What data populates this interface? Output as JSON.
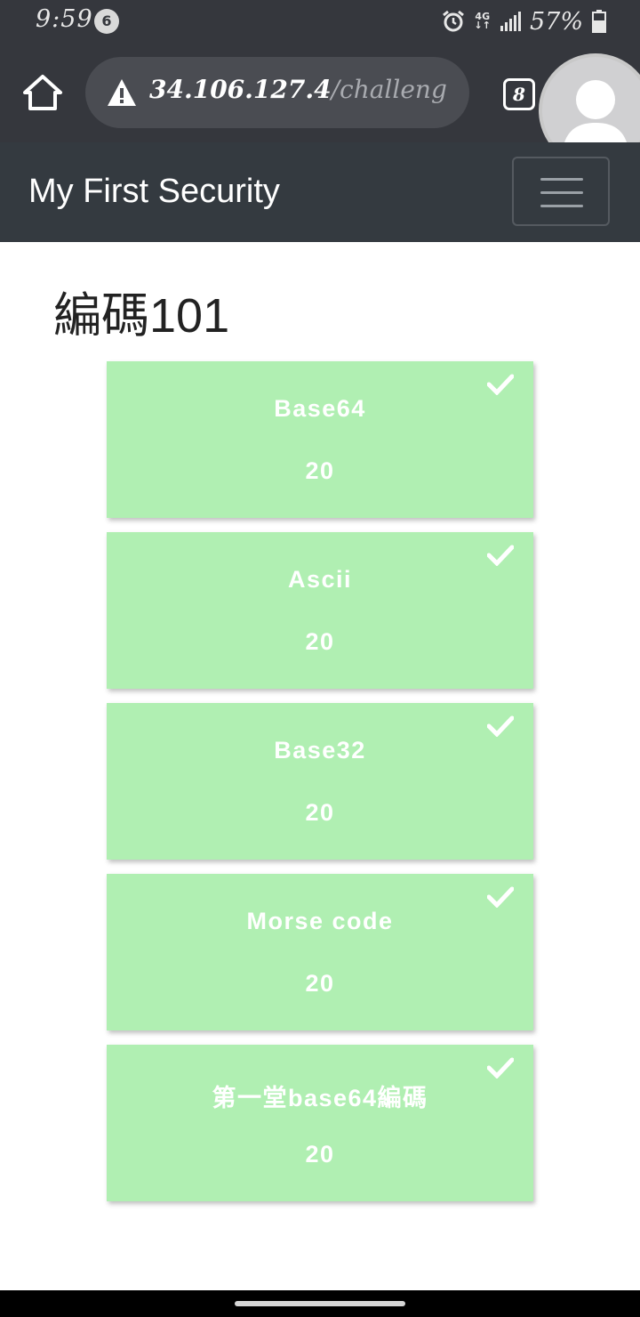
{
  "status_bar": {
    "time": "9:59",
    "notification_count": "6",
    "network": "4G",
    "battery": "57%",
    "icons": [
      "alarm-icon",
      "network-icon",
      "signal-icon",
      "battery-icon"
    ]
  },
  "browser": {
    "url_host": "34.106.127.4",
    "url_path": "/challeng",
    "tab_count": "8",
    "icons": [
      "home-icon",
      "warning-icon",
      "tabs-icon",
      "avatar-icon"
    ]
  },
  "site": {
    "brand": "My First Security",
    "menu_icon": "hamburger-icon"
  },
  "page": {
    "title": "編碼101",
    "challenges": [
      {
        "name": "Base64",
        "value": "20",
        "solved": true
      },
      {
        "name": "Ascii",
        "value": "20",
        "solved": true
      },
      {
        "name": "Base32",
        "value": "20",
        "solved": true
      },
      {
        "name": "Morse code",
        "value": "20",
        "solved": true
      },
      {
        "name": "第一堂base64編碼",
        "value": "20",
        "solved": true
      }
    ]
  },
  "colors": {
    "card_bg": "#b0efb2",
    "navbar_bg": "#343a40",
    "browser_bg": "#35373d"
  }
}
